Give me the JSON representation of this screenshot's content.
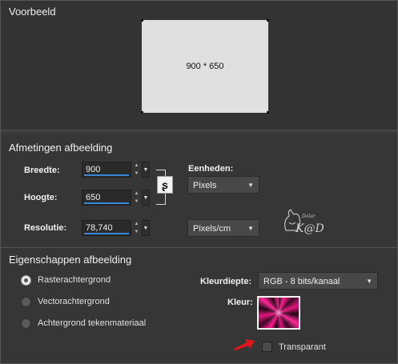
{
  "preview": {
    "heading": "Voorbeeld",
    "size_text": "900 * 650"
  },
  "dimensions": {
    "heading": "Afmetingen afbeelding",
    "width_label": "Breedte:",
    "width_value": "900",
    "height_label": "Hoogte:",
    "height_value": "650",
    "resolution_label": "Resolutie:",
    "resolution_value": "78,740",
    "units_label": "Eenheden:",
    "units_value": "Pixels",
    "resolution_units_value": "Pixels/cm",
    "link_icon": "chain-link-icon"
  },
  "properties": {
    "heading": "Eigenschappen afbeelding",
    "radio_raster": "Rasterachtergrond",
    "radio_vector": "Vectorachtergrond",
    "radio_material": "Achtergrond tekenmateriaal",
    "selected_background": "Rasterachtergrond",
    "color_depth_label": "Kleurdiepte:",
    "color_depth_value": "RGB - 8 bits/kanaal",
    "color_label": "Kleur:",
    "color_swatch": "#e0167c",
    "transparent_label": "Transparant",
    "transparent_checked": false
  },
  "logo_text": "K@D",
  "logo_small": "Dolar",
  "colors": {
    "accent_underline": "#3a86d6",
    "arrow": "#e0161c"
  }
}
